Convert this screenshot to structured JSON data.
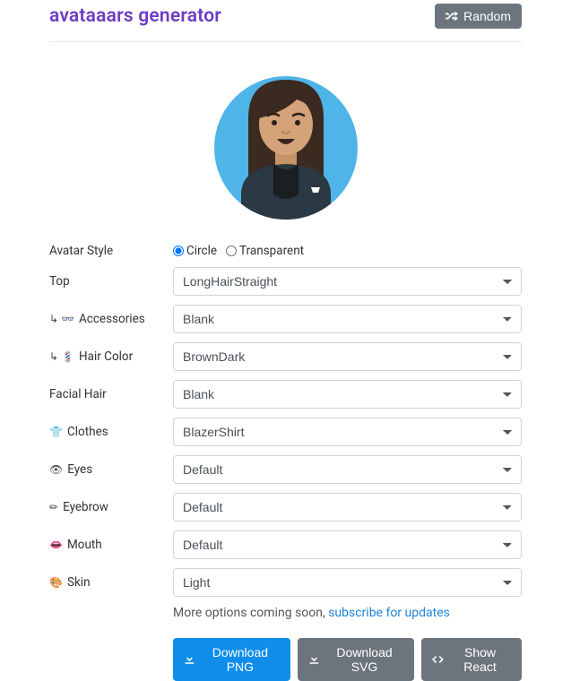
{
  "header": {
    "brand": "avataaars generator",
    "random_label": "Random"
  },
  "style_row": {
    "label": "Avatar Style",
    "opt_circle": "Circle",
    "opt_transparent": "Transparent",
    "selected": "circle"
  },
  "fields": {
    "top": {
      "icon": "",
      "label": "Top",
      "value": "LongHairStraight"
    },
    "accessories": {
      "icon": "↳ 👓",
      "label": "Accessories",
      "value": "Blank"
    },
    "haircolor": {
      "icon": "↳ 💈",
      "label": "Hair Color",
      "value": "BrownDark"
    },
    "facialhair": {
      "icon": "",
      "label": "Facial Hair",
      "value": "Blank"
    },
    "clothes": {
      "icon": "👕",
      "label": "Clothes",
      "value": "BlazerShirt"
    },
    "eyes": {
      "icon": "👁",
      "label": "Eyes",
      "value": "Default"
    },
    "eyebrow": {
      "icon": "✏",
      "label": "Eyebrow",
      "value": "Default"
    },
    "mouth": {
      "icon": "👄",
      "label": "Mouth",
      "value": "Default"
    },
    "skin": {
      "icon": "🎨",
      "label": "Skin",
      "value": "Light"
    }
  },
  "footer": {
    "more_text": "More options coming soon, ",
    "subscribe_text": "subscribe for updates",
    "download_png": "Download PNG",
    "download_svg": "Download SVG",
    "show_react": "Show React"
  },
  "colors": {
    "accent": "#6c3cc4",
    "primary_btn": "#0f8de9",
    "secondary_btn": "#6c757d",
    "avatar_bg": "#4fb4e8",
    "hair": "#3b2a20",
    "skin": "#d4a37a",
    "blazer": "#2b3944"
  }
}
